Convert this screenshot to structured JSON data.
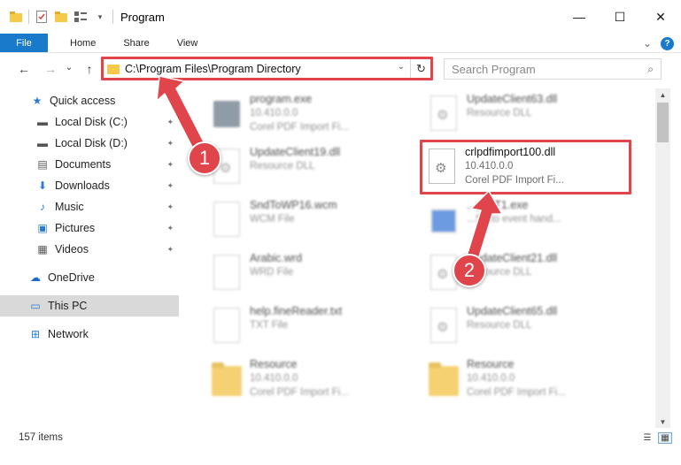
{
  "window": {
    "title": "Program",
    "minimize": "—",
    "maximize": "☐",
    "close": "✕"
  },
  "ribbon": {
    "tabs": [
      "File",
      "Home",
      "Share",
      "View"
    ],
    "collapse": "⌄",
    "help": "?"
  },
  "nav": {
    "back": "←",
    "forward": "→",
    "recent": "⌄",
    "up": "↑",
    "address_path": "C:\\Program Files\\Program Directory",
    "address_dropdown": "⌄",
    "refresh": "↻",
    "search_placeholder": "Search Program",
    "search_icon": "⌕"
  },
  "sidebar": {
    "items": [
      {
        "label": "Quick access",
        "icon": "★",
        "color": "#2a7ad5",
        "pinned": false
      },
      {
        "label": "Local Disk (C:)",
        "icon": "▬",
        "color": "#555555",
        "pinned": true
      },
      {
        "label": "Local Disk (D:)",
        "icon": "▬",
        "color": "#555555",
        "pinned": true
      },
      {
        "label": "Documents",
        "icon": "▤",
        "color": "#555555",
        "pinned": true
      },
      {
        "label": "Downloads",
        "icon": "⬇",
        "color": "#2a7ad5",
        "pinned": true
      },
      {
        "label": "Music",
        "icon": "♪",
        "color": "#2a7ad5",
        "pinned": true
      },
      {
        "label": "Pictures",
        "icon": "▣",
        "color": "#2a7ad5",
        "pinned": true
      },
      {
        "label": "Videos",
        "icon": "▦",
        "color": "#555555",
        "pinned": true
      },
      {
        "label": "OneDrive",
        "icon": "☁",
        "color": "#1c68c9",
        "pinned": false
      },
      {
        "label": "This PC",
        "icon": "▭",
        "color": "#2a7ad5",
        "pinned": false
      },
      {
        "label": "Network",
        "icon": "⊞",
        "color": "#2a7ad5",
        "pinned": false
      }
    ],
    "pin_icon": "📌"
  },
  "files": [
    {
      "name": "program.exe",
      "l1": "10.410.0.0",
      "l2": "Corel PDF Import Fi...",
      "icon": "exe",
      "blur": true
    },
    {
      "name": "UpdateClient63.dll",
      "l1": "Resource DLL",
      "l2": "",
      "icon": "dll",
      "blur": true
    },
    {
      "name": "UpdateClient19.dll",
      "l1": "Resource DLL",
      "l2": "",
      "icon": "dll",
      "blur": true
    },
    {
      "name": "crlpdfimport100.dll",
      "l1": "10.410.0.0",
      "l2": "Corel PDF Import Fi...",
      "icon": "dll",
      "blur": false
    },
    {
      "name": "SndToWP16.wcm",
      "l1": "WCM File",
      "l2": "",
      "icon": "doc",
      "blur": true
    },
    {
      "name": "...yyST1.exe",
      "l1": "...ST to event hand...",
      "l2": "",
      "icon": "exe2",
      "blur": true
    },
    {
      "name": "Arabic.wrd",
      "l1": "WRD File",
      "l2": "",
      "icon": "doc",
      "blur": true
    },
    {
      "name": "UpdateClient21.dll",
      "l1": "Resource DLL",
      "l2": "",
      "icon": "dll",
      "blur": true
    },
    {
      "name": "help.fineReader.txt",
      "l1": "TXT File",
      "l2": "",
      "icon": "doc",
      "blur": true
    },
    {
      "name": "UpdateClient65.dll",
      "l1": "Resource DLL",
      "l2": "",
      "icon": "dll",
      "blur": true
    },
    {
      "name": "Resource",
      "l1": "10.410.0.0",
      "l2": "Corel PDF Import Fi...",
      "icon": "folder",
      "blur": true
    },
    {
      "name": "Resource",
      "l1": "10.410.0.0",
      "l2": "Corel PDF Import Fi...",
      "icon": "folder",
      "blur": true
    }
  ],
  "status": {
    "items_count": "157 items"
  },
  "annotations": {
    "step1": "1",
    "step2": "2",
    "color": "#e0454b"
  }
}
